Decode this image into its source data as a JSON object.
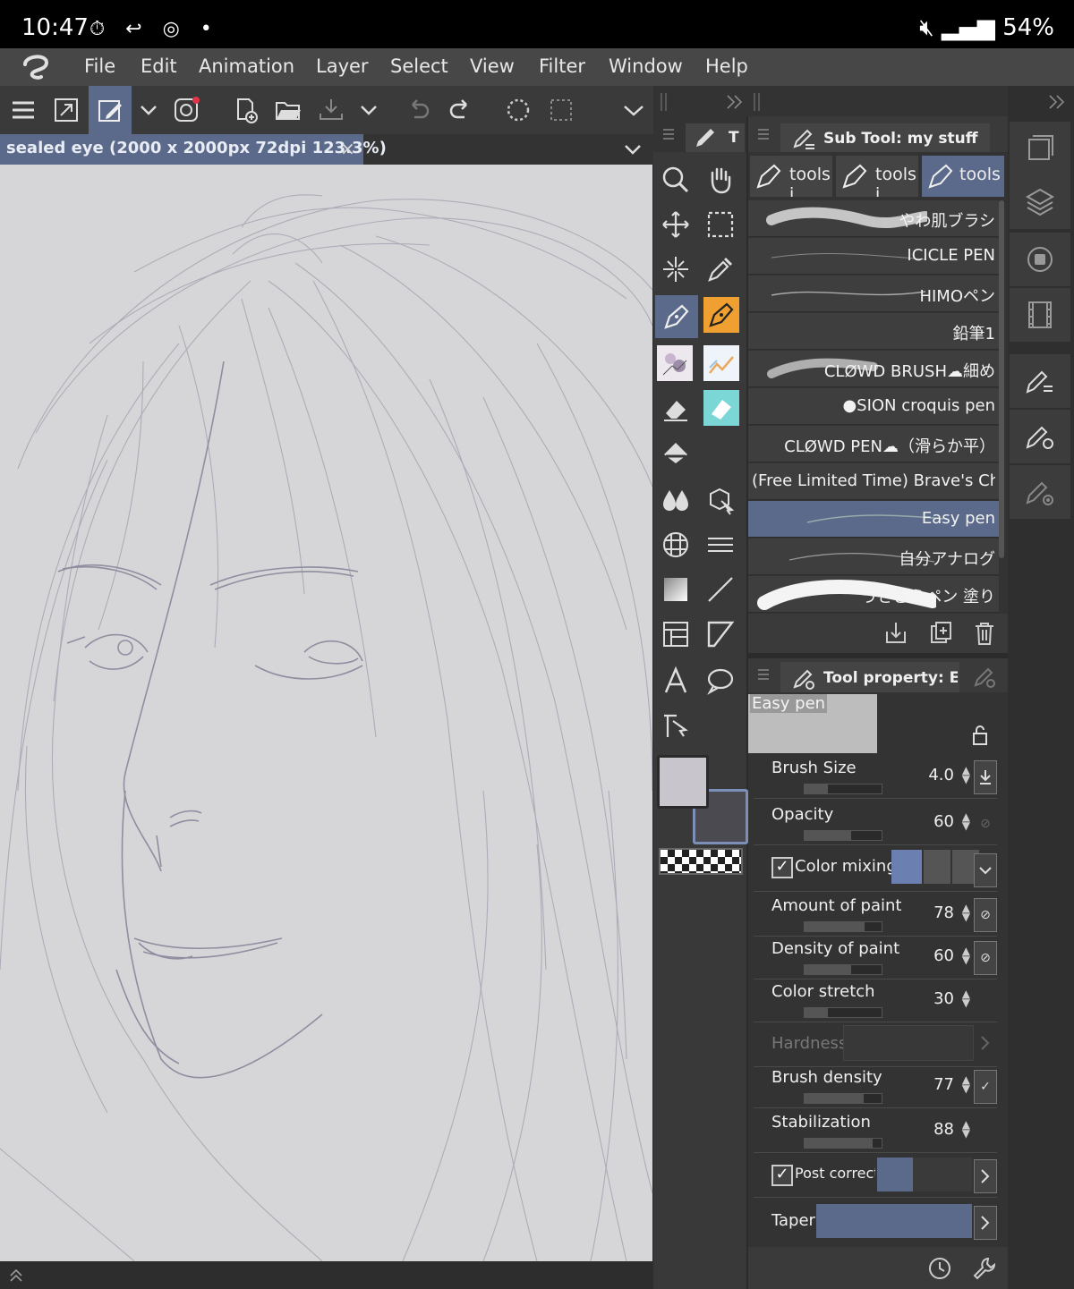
{
  "status_bar": {
    "time": "10:47",
    "battery": "54%"
  },
  "menu": {
    "items": [
      "File",
      "Edit",
      "Animation",
      "Layer",
      "Select",
      "View",
      "Filter",
      "Window",
      "Help"
    ]
  },
  "document": {
    "tab_title": "sealed eye (2000 x 2000px 72dpi 123.3%)",
    "close_glyph": "×"
  },
  "tool_palette": {
    "tab_label": "T"
  },
  "sub_tool": {
    "title": "Sub Tool: my stuff",
    "tabs": [
      "tools i",
      "tools i",
      "tools"
    ],
    "brushes": [
      {
        "name": "やわ肌ブラシ",
        "selected": false
      },
      {
        "name": "ICICLE PEN",
        "selected": false
      },
      {
        "name": "HIMOペン",
        "selected": false
      },
      {
        "name": "鉛筆1",
        "selected": false
      },
      {
        "name": "CLØWD BRUSH☁細め",
        "selected": false
      },
      {
        "name": "●SION croquis pen",
        "selected": false
      },
      {
        "name": "CLØWD PEN☁（滑らか平）",
        "selected": false
      },
      {
        "name": "(Free Limited Time) Brave's Chise",
        "selected": false
      },
      {
        "name": "Easy pen",
        "selected": true
      },
      {
        "name": "自分アナログ",
        "selected": false
      },
      {
        "name": "うさぎらペン 塗り",
        "selected": false
      }
    ]
  },
  "tool_property": {
    "title": "Tool property: Eas",
    "preview_label": "Easy pen",
    "rows": [
      {
        "label": "Brush Size",
        "value": "4.0",
        "level": 0.3
      },
      {
        "label": "Opacity",
        "value": "60",
        "level": 0.6
      },
      {
        "label": "Color mixing",
        "checked": true
      },
      {
        "label": "Amount of paint",
        "value": "78",
        "level": 0.78
      },
      {
        "label": "Density of paint",
        "value": "60",
        "level": 0.6
      },
      {
        "label": "Color stretch",
        "value": "30",
        "level": 0.3
      },
      {
        "label": "Hardness"
      },
      {
        "label": "Brush density",
        "value": "77",
        "level": 0.77
      },
      {
        "label": "Stabilization",
        "value": "88",
        "level": 0.88
      },
      {
        "label": "Post correctio",
        "checked": true
      },
      {
        "label": "Taper"
      }
    ]
  },
  "colors": {
    "accent": "#5b6a8a",
    "orange": "#f0a030",
    "canvas": "#d6d6d8",
    "sketch": "#9a9aa6"
  }
}
